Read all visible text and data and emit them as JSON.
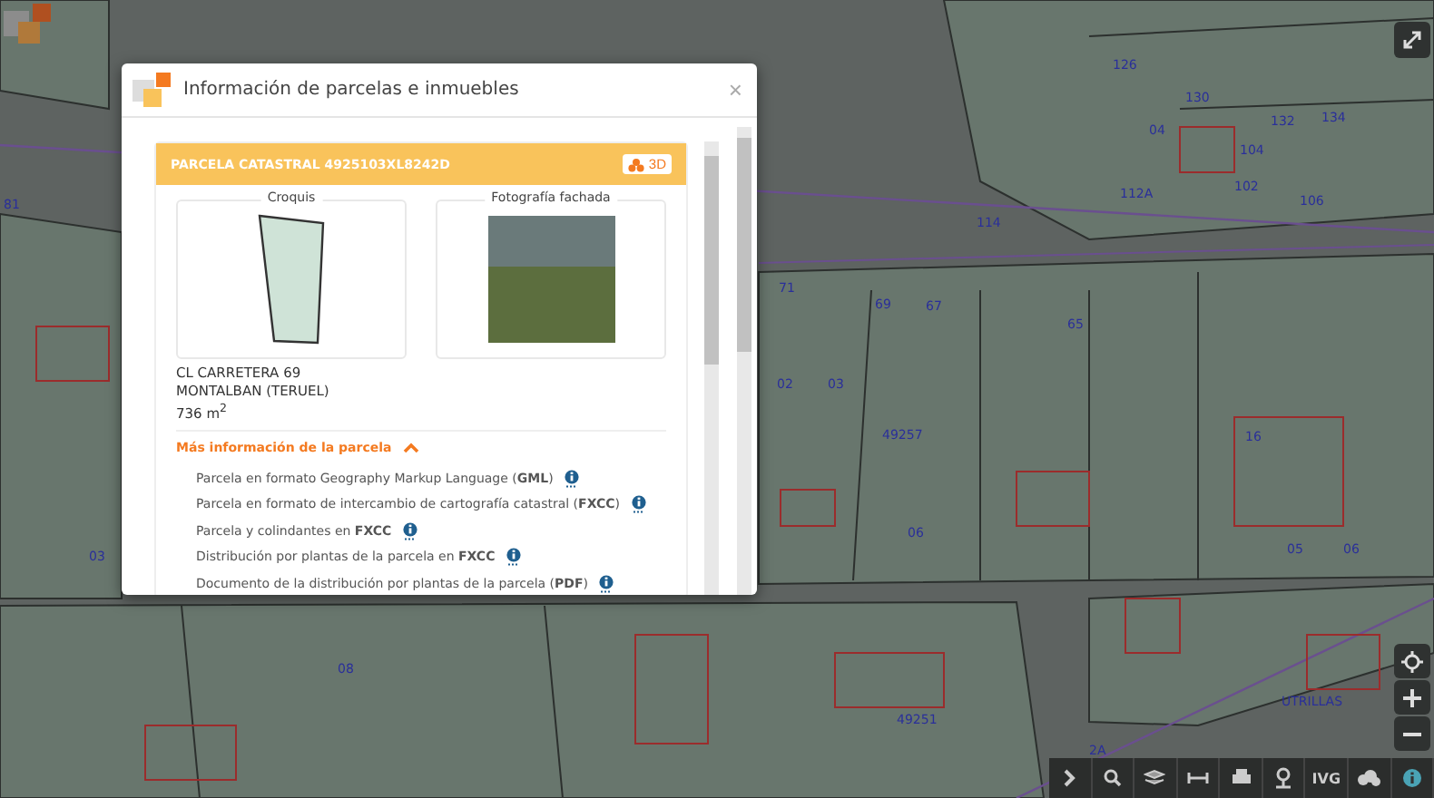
{
  "map": {
    "labels": [
      {
        "text": "126"
      },
      {
        "text": "130"
      },
      {
        "text": "04"
      },
      {
        "text": "132"
      },
      {
        "text": "134"
      },
      {
        "text": "104"
      },
      {
        "text": "102"
      },
      {
        "text": "106"
      },
      {
        "text": "112A"
      },
      {
        "text": "114"
      },
      {
        "text": "71"
      },
      {
        "text": "69"
      },
      {
        "text": "67"
      },
      {
        "text": "65"
      },
      {
        "text": "02"
      },
      {
        "text": "03"
      },
      {
        "text": "49257"
      },
      {
        "text": "16"
      },
      {
        "text": "06"
      },
      {
        "text": "03"
      },
      {
        "text": "08"
      },
      {
        "text": "49251"
      },
      {
        "text": "2A"
      },
      {
        "text": "UTRILLAS"
      },
      {
        "text": "81"
      },
      {
        "text": "05"
      },
      {
        "text": "06"
      }
    ]
  },
  "dialog": {
    "title": "Información de parcelas e inmuebles",
    "close": "×",
    "parcel": {
      "title": "PARCELA CATASTRAL 4925103XL8242D",
      "button_3d": "3D",
      "sketch_legend": "Croquis",
      "photo_legend": "Fotografía fachada",
      "address": [
        "CL CARRETERA 69",
        "MONTALBAN (TERUEL)",
        "736 m$^{2}$"
      ],
      "more_info": {
        "label": "Más información de la parcela",
        "expanded": true,
        "links": [
          "Parcela en formato Geography Markup Language (**GML**)",
          "Parcela en formato de intercambio de cartografía catastral (**FXCC**)",
          "Parcela y colindantes en **FXCC**",
          "Distribución por plantas de la parcela en **FXCC**",
          "Documento de la distribución por plantas de la parcela (**PDF**)"
        ]
      }
    }
  },
  "toolbar": {
    "items": [
      {
        "kind": "chevron"
      },
      {
        "kind": "search"
      },
      {
        "kind": "layers"
      },
      {
        "kind": "measure"
      },
      {
        "kind": "print"
      },
      {
        "kind": "pin"
      },
      {
        "kind": "text",
        "label": "IVG"
      },
      {
        "kind": "cloud"
      },
      {
        "kind": "info"
      }
    ]
  }
}
